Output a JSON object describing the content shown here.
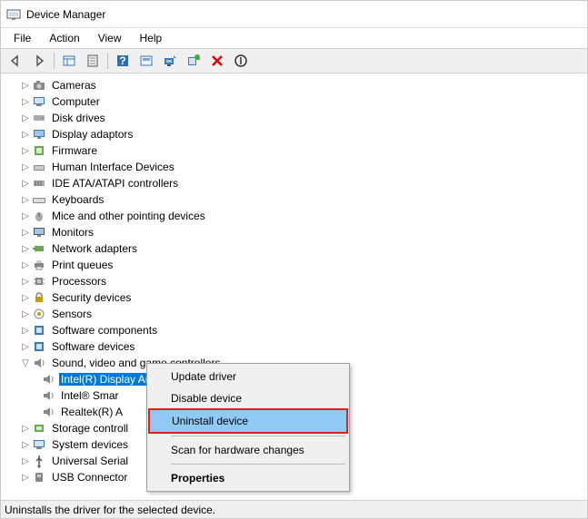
{
  "window": {
    "title": "Device Manager"
  },
  "menu": {
    "items": [
      "File",
      "Action",
      "View",
      "Help"
    ]
  },
  "tree": {
    "categories": [
      {
        "label": "Cameras",
        "icon": "camera"
      },
      {
        "label": "Computer",
        "icon": "computer"
      },
      {
        "label": "Disk drives",
        "icon": "disk"
      },
      {
        "label": "Display adaptors",
        "icon": "display"
      },
      {
        "label": "Firmware",
        "icon": "firmware"
      },
      {
        "label": "Human Interface Devices",
        "icon": "hid"
      },
      {
        "label": "IDE ATA/ATAPI controllers",
        "icon": "ide"
      },
      {
        "label": "Keyboards",
        "icon": "keyboard"
      },
      {
        "label": "Mice and other pointing devices",
        "icon": "mouse"
      },
      {
        "label": "Monitors",
        "icon": "monitor"
      },
      {
        "label": "Network adapters",
        "icon": "network"
      },
      {
        "label": "Print queues",
        "icon": "printer"
      },
      {
        "label": "Processors",
        "icon": "cpu"
      },
      {
        "label": "Security devices",
        "icon": "security"
      },
      {
        "label": "Sensors",
        "icon": "sensor"
      },
      {
        "label": "Software components",
        "icon": "software"
      },
      {
        "label": "Software devices",
        "icon": "software"
      }
    ],
    "expanded": {
      "label": "Sound, video and game controllers",
      "children": [
        {
          "label": "Intel(R) Display Audio",
          "selected": true
        },
        {
          "label": "Intel® Smar"
        },
        {
          "label": "Realtek(R) A"
        }
      ]
    },
    "after": [
      {
        "label": "Storage controll",
        "icon": "storage"
      },
      {
        "label": "System devices",
        "icon": "system"
      },
      {
        "label": "Universal Serial",
        "icon": "usb"
      },
      {
        "label": "USB Connector",
        "icon": "usbconn"
      }
    ]
  },
  "context_menu": {
    "items": [
      {
        "label": "Update driver"
      },
      {
        "label": "Disable device"
      },
      {
        "label": "Uninstall device",
        "highlight": true
      },
      {
        "sep": true
      },
      {
        "label": "Scan for hardware changes"
      },
      {
        "sep": true
      },
      {
        "label": "Properties",
        "bold": true
      }
    ]
  },
  "statusbar": {
    "text": "Uninstalls the driver for the selected device."
  }
}
